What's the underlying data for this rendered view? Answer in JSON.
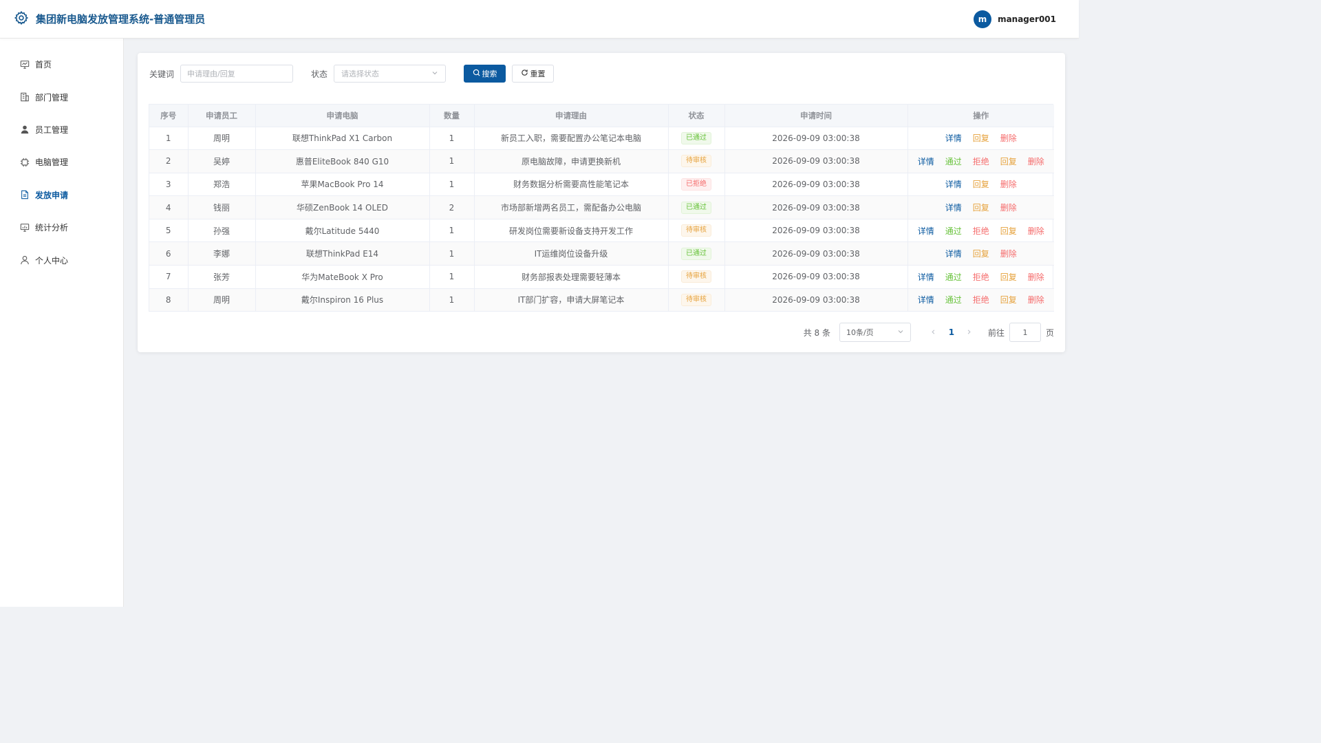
{
  "header": {
    "title": "集团新电脑发放管理系统-普通管理员",
    "avatar_initial": "m",
    "username": "manager001"
  },
  "sidebar": {
    "items": [
      {
        "label": "首页",
        "icon": "dashboard-icon"
      },
      {
        "label": "部门管理",
        "icon": "building-icon"
      },
      {
        "label": "员工管理",
        "icon": "user-icon"
      },
      {
        "label": "电脑管理",
        "icon": "cpu-icon"
      },
      {
        "label": "发放申请",
        "icon": "document-icon",
        "active": true
      },
      {
        "label": "统计分析",
        "icon": "chart-icon"
      },
      {
        "label": "个人中心",
        "icon": "person-icon"
      }
    ]
  },
  "filters": {
    "keyword_label": "关键词",
    "keyword_placeholder": "申请理由/回复",
    "status_label": "状态",
    "status_placeholder": "请选择状态",
    "search_label": "搜索",
    "reset_label": "重置"
  },
  "table": {
    "columns": [
      "序号",
      "申请员工",
      "申请电脑",
      "数量",
      "申请理由",
      "状态",
      "申请时间",
      "操作"
    ],
    "rows": [
      {
        "no": "1",
        "employee": "周明",
        "computer": "联想ThinkPad X1 Carbon",
        "qty": "1",
        "reason": "新员工入职，需要配置办公笔记本电脑",
        "status": "已通过",
        "status_type": "approved",
        "time": "2026-09-09 03:00:38"
      },
      {
        "no": "2",
        "employee": "吴婷",
        "computer": "惠普EliteBook 840 G10",
        "qty": "1",
        "reason": "原电脑故障，申请更换新机",
        "status": "待审核",
        "status_type": "pending",
        "time": "2026-09-09 03:00:38"
      },
      {
        "no": "3",
        "employee": "郑浩",
        "computer": "苹果MacBook Pro 14",
        "qty": "1",
        "reason": "财务数据分析需要高性能笔记本",
        "status": "已拒绝",
        "status_type": "rejected",
        "time": "2026-09-09 03:00:38"
      },
      {
        "no": "4",
        "employee": "钱丽",
        "computer": "华硕ZenBook 14 OLED",
        "qty": "2",
        "reason": "市场部新增两名员工，需配备办公电脑",
        "status": "已通过",
        "status_type": "approved",
        "time": "2026-09-09 03:00:38"
      },
      {
        "no": "5",
        "employee": "孙强",
        "computer": "戴尔Latitude 5440",
        "qty": "1",
        "reason": "研发岗位需要新设备支持开发工作",
        "status": "待审核",
        "status_type": "pending",
        "time": "2026-09-09 03:00:38"
      },
      {
        "no": "6",
        "employee": "李娜",
        "computer": "联想ThinkPad E14",
        "qty": "1",
        "reason": "IT运维岗位设备升级",
        "status": "已通过",
        "status_type": "approved",
        "time": "2026-09-09 03:00:38"
      },
      {
        "no": "7",
        "employee": "张芳",
        "computer": "华为MateBook X Pro",
        "qty": "1",
        "reason": "财务部报表处理需要轻薄本",
        "status": "待审核",
        "status_type": "pending",
        "time": "2026-09-09 03:00:38"
      },
      {
        "no": "8",
        "employee": "周明",
        "computer": "戴尔Inspiron 16 Plus",
        "qty": "1",
        "reason": "IT部门扩容，申请大屏笔记本",
        "status": "待审核",
        "status_type": "pending",
        "time": "2026-09-09 03:00:38"
      }
    ],
    "ops": {
      "detail": "详情",
      "pass": "通过",
      "reject": "拒绝",
      "reply": "回复",
      "delete": "删除"
    }
  },
  "pagination": {
    "total": "共 8 条",
    "page_size": "10条/页",
    "current_page": "1",
    "goto_label": "前往",
    "goto_value": "1",
    "page_suffix": "页"
  },
  "colors": {
    "primary": "#0b5aa0",
    "approved": "#67c23a",
    "pending": "#e6a23c",
    "rejected": "#f56c6c"
  }
}
